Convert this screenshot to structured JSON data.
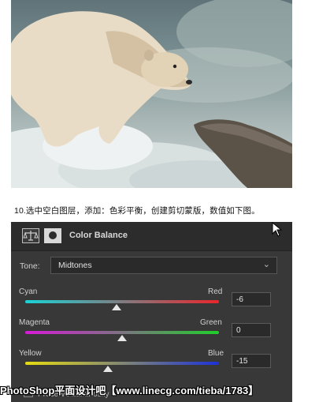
{
  "caption": "10.选中空白图层，添加：色彩平衡，创建剪切蒙版，数值如下图。",
  "panel": {
    "title": "Color Balance",
    "tone_label": "Tone:",
    "tone_value": "Midtones"
  },
  "sliders": [
    {
      "left": "Cyan",
      "right": "Red",
      "value": "-6",
      "level": -6
    },
    {
      "left": "Magenta",
      "right": "Green",
      "value": "0",
      "level": 0
    },
    {
      "left": "Yellow",
      "right": "Blue",
      "value": "-15",
      "level": -15
    }
  ],
  "preserve_label": "Preserve Luminosity",
  "watermark": "PhotoShop平面设计吧【www.linecg.com/tieba/1783】",
  "colors": {
    "cyan_red": [
      "#19d3d6",
      "#e8262c"
    ],
    "magenta_green": [
      "#d81ad8",
      "#1fcf2a"
    ],
    "yellow_blue": [
      "#e6dc12",
      "#1d32d8"
    ]
  },
  "icons": [
    "scale-icon",
    "mask-icon",
    "cursor-icon",
    "chevron-down-icon"
  ]
}
